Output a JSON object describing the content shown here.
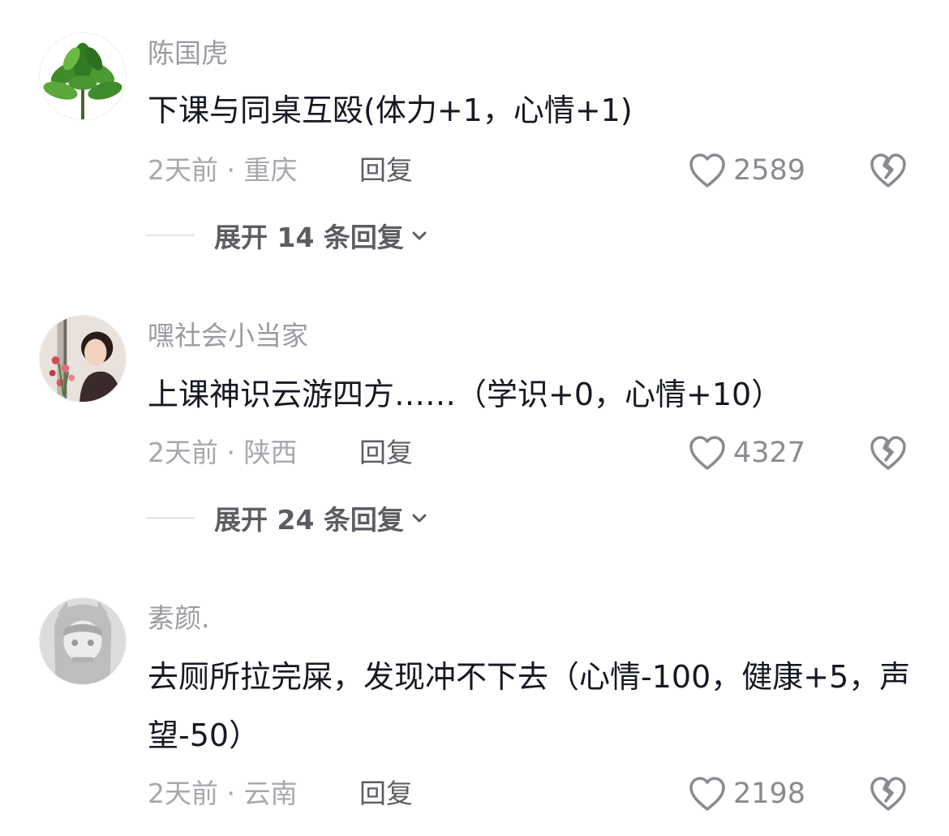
{
  "comments": [
    {
      "username": "陈国虎",
      "text": "下课与同桌互殴(体力+1，心情+1)",
      "meta": "2天前 · 重庆",
      "reply": "回复",
      "likes": "2589",
      "expand": "展开 14 条回复",
      "avatar": "plant-avatar"
    },
    {
      "username": "嘿社会小当家",
      "text": "上课神识云游四方……（学识+0，心情+10）",
      "meta": "2天前 · 陕西",
      "reply": "回复",
      "likes": "4327",
      "expand": "展开 24 条回复",
      "avatar": "woman-flowers-avatar"
    },
    {
      "username": "素颜.",
      "text": "去厕所拉完屎，发现冲不下去（心情-100，健康+5，声望-50）",
      "meta": "2天前 · 云南",
      "reply": "回复",
      "likes": "2198",
      "avatar": "anime-girl-avatar"
    }
  ],
  "colors": {
    "username": "#9b9ca2",
    "text": "#161823",
    "meta": "#a7a8ad",
    "icon": "#8a8b91"
  }
}
